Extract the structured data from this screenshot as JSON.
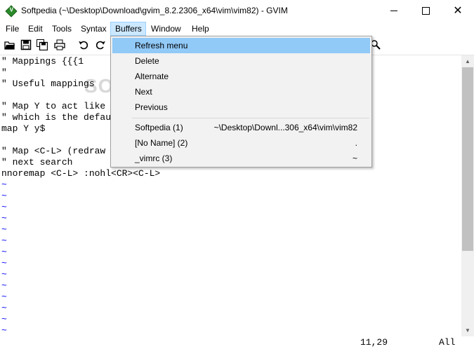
{
  "window": {
    "title": "Softpedia (~\\Desktop\\Download\\gvim_8.2.2306_x64\\vim\\vim82) - GVIM",
    "close_glyph": "✕"
  },
  "menubar": {
    "items": [
      "File",
      "Edit",
      "Tools",
      "Syntax",
      "Buffers",
      "Window",
      "Help"
    ],
    "active": "Buffers"
  },
  "toolbar": {
    "icons": [
      "open-icon",
      "save-icon",
      "save-all-icon",
      "print-icon",
      "undo-icon",
      "redo-icon",
      "find-help-icon"
    ]
  },
  "watermark": "SOFTPEDIA",
  "editor": {
    "lines": [
      "\" Mappings {{{1",
      "\"",
      "\" Useful mappings",
      "",
      "\" Map Y to act like                                      ct as yy,",
      "\" which is the defau",
      "map Y y$",
      "",
      "\" Map <C-L> (redraw                                     ntil the",
      "\" next search",
      "nnoremap <C-L> :nohl<CR><C-L>"
    ],
    "tilde": "~",
    "tilde_count": 14
  },
  "statusbar": {
    "position": "11,29",
    "scroll": "All"
  },
  "buffers_menu": {
    "items": [
      {
        "label": "Refresh menu",
        "path": ""
      },
      {
        "label": "Delete",
        "path": ""
      },
      {
        "label": "Alternate",
        "path": ""
      },
      {
        "label": "Next",
        "path": ""
      },
      {
        "label": "Previous",
        "path": ""
      },
      {
        "label": "Softpedia (1)",
        "path": "~\\Desktop\\Downl...306_x64\\vim\\vim82"
      },
      {
        "label": "[No Name] (2)",
        "path": "."
      },
      {
        "label": "_vimrc (3)",
        "path": "~"
      }
    ],
    "highlighted": "Refresh menu"
  },
  "colors": {
    "tilde": "#0000ff",
    "menu_highlight": "#91c9f7",
    "menubar_active": "#cce8ff"
  }
}
